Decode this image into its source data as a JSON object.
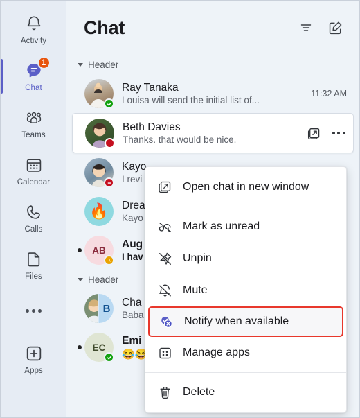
{
  "rail": {
    "items": [
      {
        "label": "Activity",
        "icon": "bell-icon",
        "active": false,
        "badge": null
      },
      {
        "label": "Chat",
        "icon": "chat-icon",
        "active": true,
        "badge": "1"
      },
      {
        "label": "Teams",
        "icon": "teams-icon",
        "active": false,
        "badge": null
      },
      {
        "label": "Calendar",
        "icon": "calendar-icon",
        "active": false,
        "badge": null
      },
      {
        "label": "Calls",
        "icon": "phone-icon",
        "active": false,
        "badge": null
      },
      {
        "label": "Files",
        "icon": "file-icon",
        "active": false,
        "badge": null
      },
      {
        "label": "",
        "icon": "more-icon",
        "active": false,
        "badge": null
      },
      {
        "label": "Apps",
        "icon": "apps-plus-icon",
        "active": false,
        "badge": null
      }
    ]
  },
  "header": {
    "title": "Chat",
    "filter_icon": "filter-icon",
    "compose_icon": "compose-chat-icon"
  },
  "groups": [
    {
      "label": "Header",
      "rows": [
        {
          "name": "Ray Tanaka",
          "preview": "Louisa will send the initial list of...",
          "time": "11:32 AM",
          "presence": "available",
          "avatar_kind": "photo-man-child",
          "unread": false,
          "selected": false,
          "bold": false
        },
        {
          "name": "Beth Davies",
          "preview": "Thanks. that would be nice.",
          "time": "",
          "presence": "busy",
          "avatar_kind": "photo-woman-dark",
          "unread": false,
          "selected": true,
          "bold": false,
          "hover_icons": [
            "open-in-new-window-icon",
            "more-options-icon"
          ]
        },
        {
          "name": "Kayo",
          "preview": "I revi",
          "time": "",
          "presence": "dnd",
          "avatar_kind": "photo-woman-asian",
          "unread": false,
          "selected": false,
          "bold": false
        },
        {
          "name": "Drea",
          "preview": "Kayo",
          "time": "",
          "presence": "none",
          "avatar_kind": "emoji-fire",
          "unread": false,
          "selected": false,
          "bold": false
        },
        {
          "name": "Aug",
          "preview": "I hav",
          "time": "",
          "presence": "away",
          "avatar_kind": "initials-AB",
          "initials": "AB",
          "unread": true,
          "selected": false,
          "bold": true
        }
      ]
    },
    {
      "label": "Header",
      "rows": [
        {
          "name": "Cha",
          "preview": "Baba",
          "time": "",
          "presence": "none",
          "avatar_kind": "group-split-B",
          "initials": "B",
          "unread": false,
          "selected": false,
          "bold": false
        },
        {
          "name": "Emi",
          "preview": "😂😂",
          "time": "",
          "presence": "available",
          "avatar_kind": "initials-EC",
          "initials": "EC",
          "unread": true,
          "selected": false,
          "bold": true
        }
      ]
    }
  ],
  "context_menu": {
    "items": [
      {
        "label": "Open chat in new window",
        "icon": "open-in-new-window-icon",
        "highlighted": false,
        "separator_after": true
      },
      {
        "label": "Mark as unread",
        "icon": "mark-unread-icon",
        "highlighted": false,
        "separator_after": false
      },
      {
        "label": "Unpin",
        "icon": "unpin-icon",
        "highlighted": false,
        "separator_after": false
      },
      {
        "label": "Mute",
        "icon": "mute-bell-icon",
        "highlighted": false,
        "separator_after": false
      },
      {
        "label": "Notify when available",
        "icon": "notify-available-icon",
        "highlighted": true,
        "separator_after": false
      },
      {
        "label": "Manage apps",
        "icon": "manage-apps-icon",
        "highlighted": false,
        "separator_after": true
      },
      {
        "label": "Delete",
        "icon": "delete-trash-icon",
        "highlighted": false,
        "separator_after": false
      }
    ]
  },
  "colors": {
    "accent": "#5b5fc7",
    "badge": "#e8540c",
    "available": "#13a10e",
    "busy": "#c50f1f",
    "away": "#eaa300",
    "highlight_border": "#e8382c"
  }
}
